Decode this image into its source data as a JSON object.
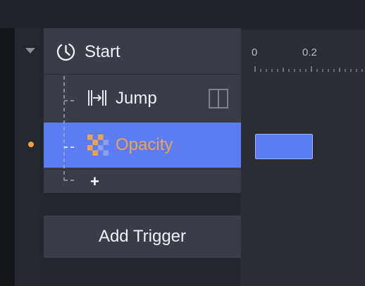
{
  "tree": {
    "start_label": "Start",
    "jump_label": "Jump",
    "opacity_label": "Opacity",
    "add_symbol": "+"
  },
  "add_trigger_label": "Add Trigger",
  "timeline": {
    "ticks": [
      "0",
      "0.2"
    ]
  },
  "colors": {
    "selection": "#5b7cf2",
    "accent_orange": "#f0a34a",
    "panel": "#3a3d47"
  }
}
